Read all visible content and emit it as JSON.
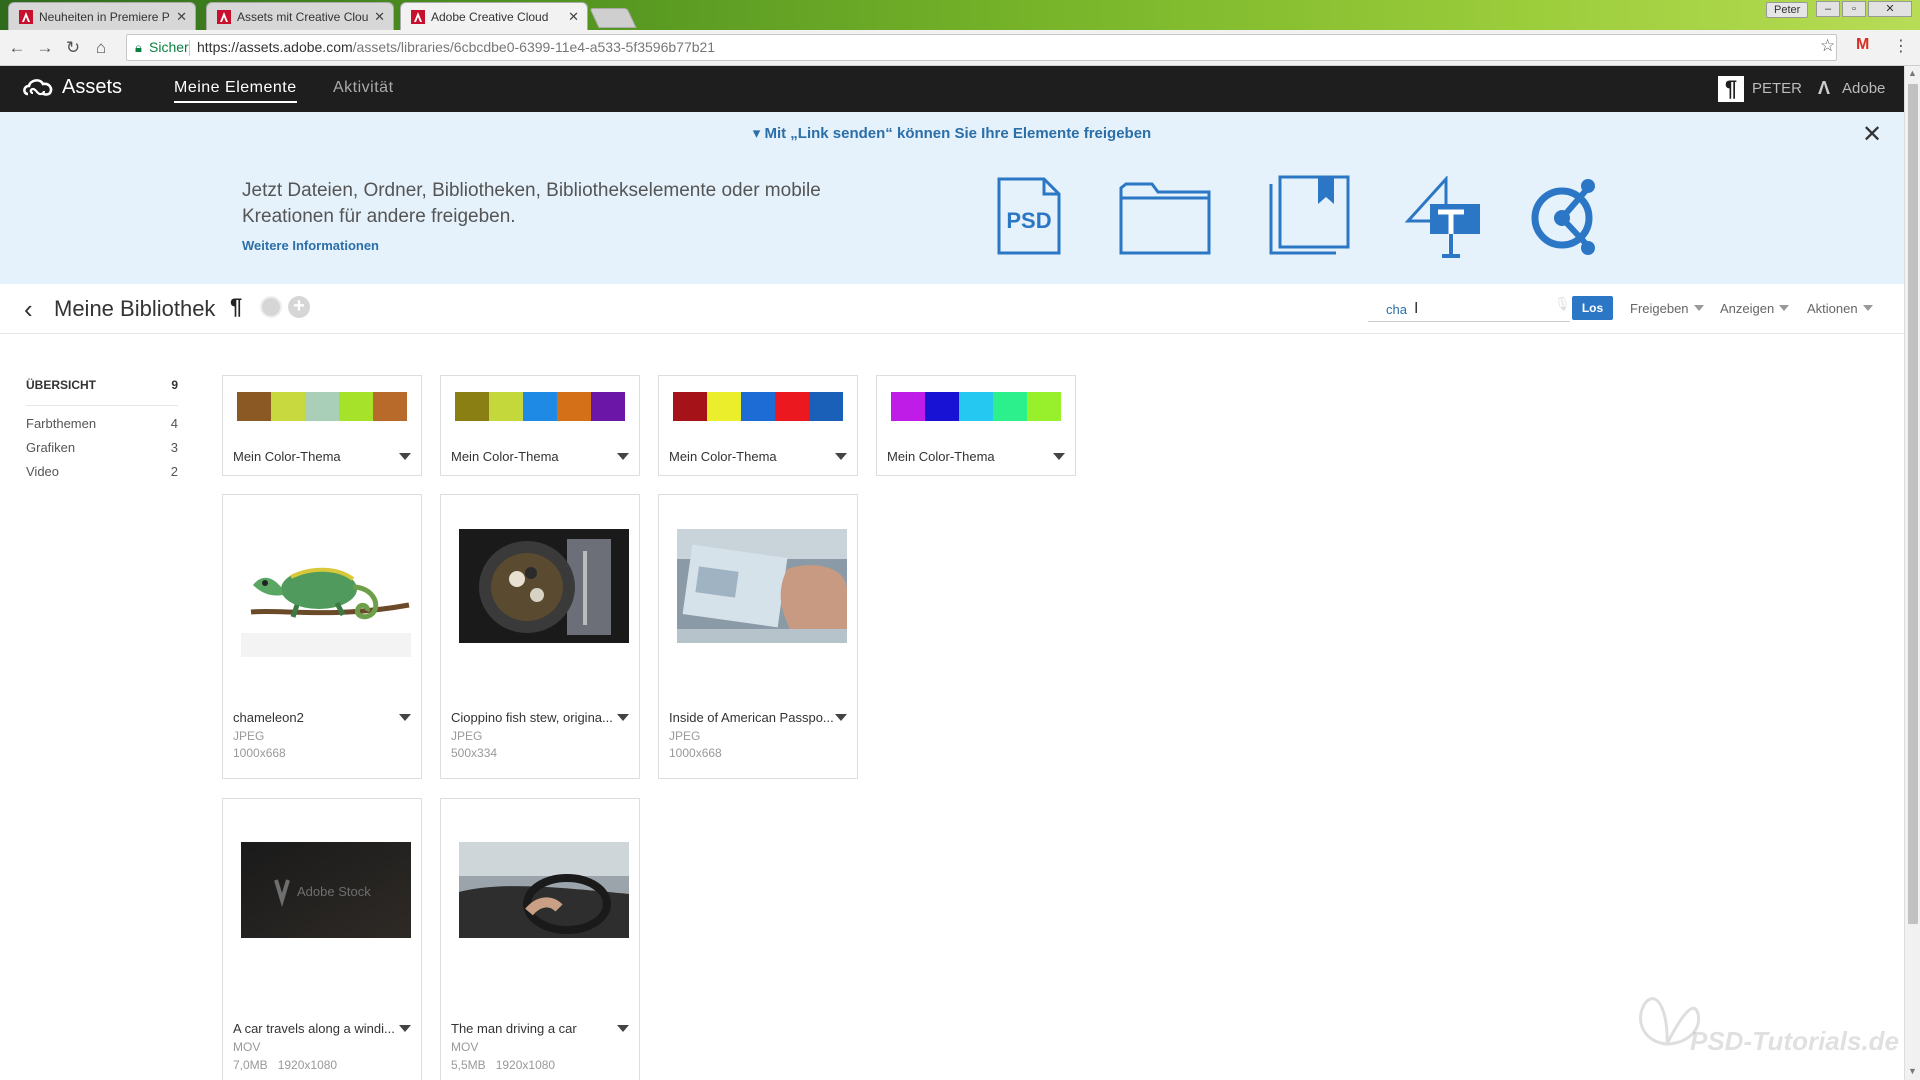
{
  "browser": {
    "tabs": [
      {
        "title": "Neuheiten in Premiere P",
        "active": false
      },
      {
        "title": "Assets mit Creative Clou",
        "active": false
      },
      {
        "title": "Adobe Creative Cloud",
        "active": true
      }
    ],
    "profile": "Peter",
    "secure_label": "Sicher",
    "url_host": "https://assets.adobe.com",
    "url_path": "/assets/libraries/6cbcdbe0-6399-11e4-a533-5f3596b77b21"
  },
  "app": {
    "title": "Assets",
    "nav": {
      "elements": "Meine Elemente",
      "activity": "Aktivität"
    },
    "user": {
      "icon_letter": "¶",
      "name": "PETER"
    },
    "adobe_label": "Adobe"
  },
  "banner": {
    "headline": "▾ Mit „Link senden“ können Sie Ihre Elemente freigeben",
    "description": "Jetzt Dateien, Ordner, Bibliotheken, Bibliothekselemente oder mobile Kreationen für andere freigeben.",
    "link": "Weitere Informationen",
    "psd_label": "PSD",
    "accent_color": "#2b76c5"
  },
  "library": {
    "title": "Meine Bibliothek",
    "search": {
      "value": "cha"
    },
    "go_label": "Los",
    "menus": {
      "share": "Freigeben",
      "view": "Anzeigen",
      "actions": "Aktionen"
    }
  },
  "sidebar": {
    "overview": {
      "label": "ÜBERSICHT",
      "count": "9"
    },
    "items": [
      {
        "label": "Farbthemen",
        "count": "4"
      },
      {
        "label": "Grafiken",
        "count": "3"
      },
      {
        "label": "Video",
        "count": "2"
      }
    ]
  },
  "color_themes": [
    {
      "name": "Mein Color-Thema",
      "colors": [
        "#8b5a24",
        "#c8d83f",
        "#a9cfb8",
        "#a6e22a",
        "#b86a2a"
      ]
    },
    {
      "name": "Mein Color-Thema",
      "colors": [
        "#8a7f13",
        "#c4d83c",
        "#1e8ae6",
        "#d47017",
        "#6c16a8"
      ]
    },
    {
      "name": "Mein Color-Thema",
      "colors": [
        "#a51319",
        "#eaee2b",
        "#1d6cd6",
        "#ec1820",
        "#1a60b8"
      ]
    },
    {
      "name": "Mein Color-Thema",
      "colors": [
        "#c01ce8",
        "#1712d4",
        "#25c8f0",
        "#2cf08c",
        "#98f02c"
      ]
    }
  ],
  "graphics": [
    {
      "name": "chameleon2",
      "type": "JPEG",
      "dims": "1000x668"
    },
    {
      "name": "Cioppino fish stew, origina...",
      "type": "JPEG",
      "dims": "500x334"
    },
    {
      "name": "Inside of American Passpo...",
      "type": "JPEG",
      "dims": "1000x668"
    }
  ],
  "videos": [
    {
      "name": "A car travels along a windi...",
      "type": "MOV",
      "size": "7,0MB",
      "dims": "1920x1080",
      "thumb_text": "Adobe Stock"
    },
    {
      "name": "The man driving a car",
      "type": "MOV",
      "size": "5,5MB",
      "dims": "1920x1080"
    }
  ],
  "watermark": "PSD-Tutorials.de"
}
